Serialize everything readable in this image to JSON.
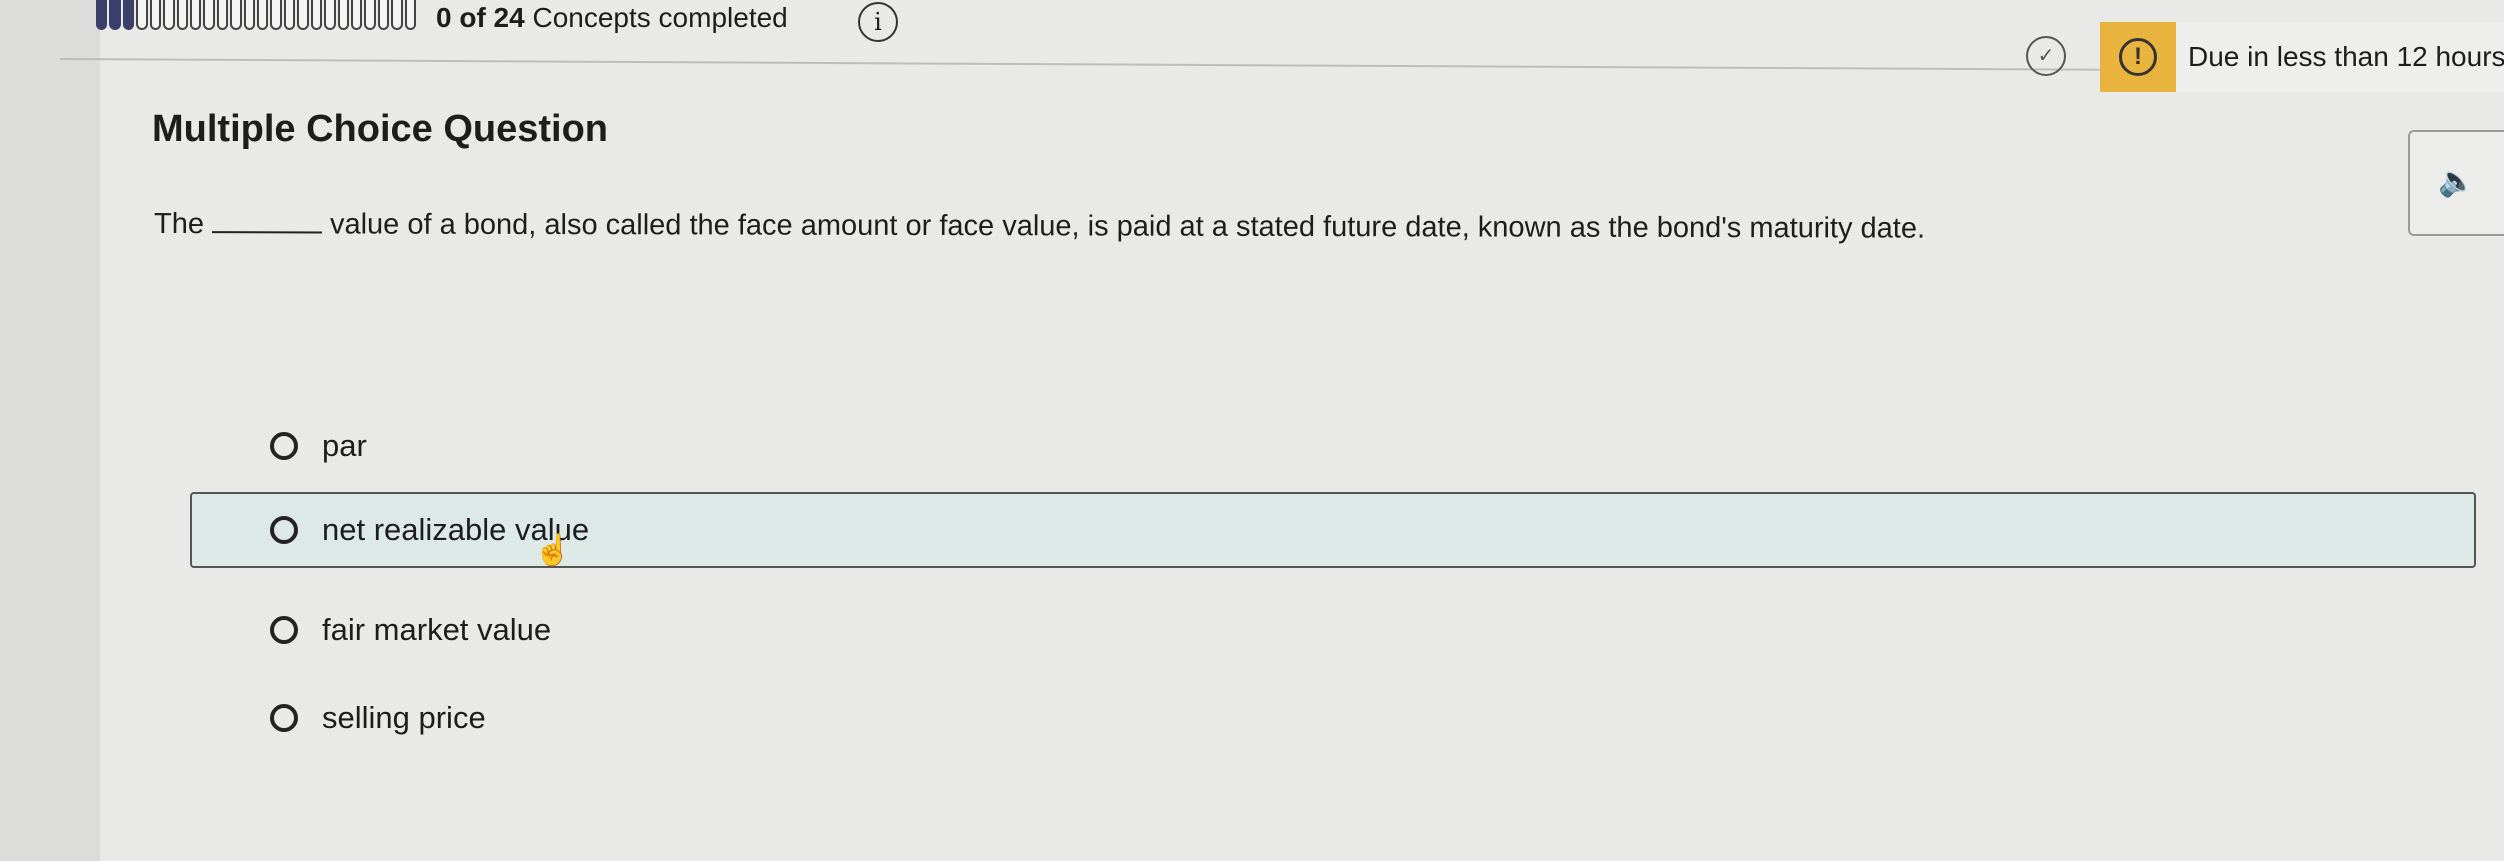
{
  "progress": {
    "count_text": "0 of 24",
    "label": "Concepts completed",
    "info_icon": "info-icon"
  },
  "status": {
    "check_icon": "check-circle-icon",
    "warning_icon": "warning-icon",
    "due_text": "Due in less than 12 hours",
    "badge_color": "#e9b43d"
  },
  "question": {
    "type_title": "Multiple Choice Question",
    "prompt_start": "The",
    "prompt_end": "value of a bond, also called the face amount or face value, is paid at a stated future date, known as the bond's maturity date.",
    "audio_icon": "speaker-icon"
  },
  "options": [
    {
      "label": "par"
    },
    {
      "label": "net realizable value"
    },
    {
      "label": "fair market value"
    },
    {
      "label": "selling price"
    }
  ],
  "highlighted_option_color": "#dde9e7"
}
